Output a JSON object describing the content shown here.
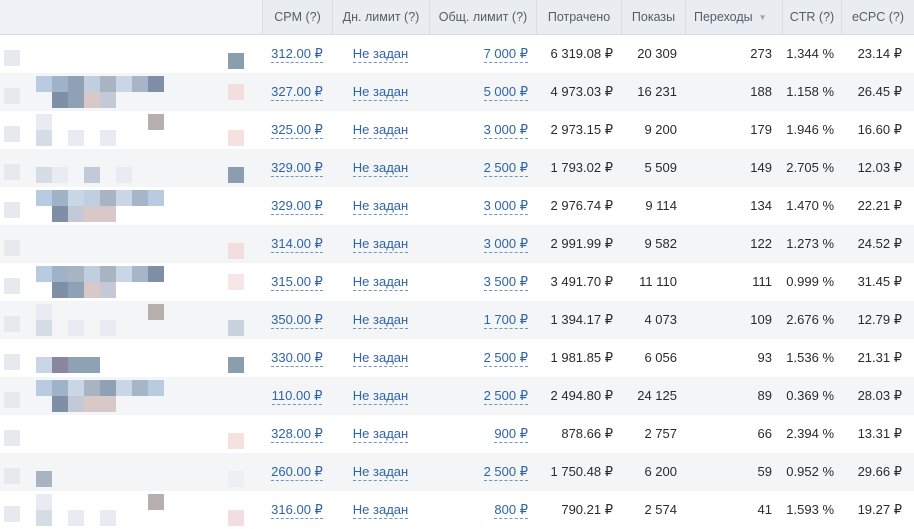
{
  "table": {
    "headers": {
      "cpm": "CPM (?)",
      "daily_limit": "Дн. лимит (?)",
      "total_limit": "Общ. лимит (?)",
      "spent": "Потрачено",
      "impressions": "Показы",
      "clicks": "Переходы",
      "ctr": "CTR (?)",
      "ecpc": "eCPC (?)"
    },
    "sorted_by": "clicks",
    "sort_direction": "descending",
    "rows": [
      {
        "cpm": "312.00 ₽",
        "daily": "Не задан",
        "total": "7 000 ₽",
        "spent": "6 319.08 ₽",
        "impressions": "20 309",
        "clicks": "273",
        "ctr": "1.344 %",
        "ecpc": "23.14 ₽"
      },
      {
        "cpm": "327.00 ₽",
        "daily": "Не задан",
        "total": "5 000 ₽",
        "spent": "4 973.03 ₽",
        "impressions": "16 231",
        "clicks": "188",
        "ctr": "1.158 %",
        "ecpc": "26.45 ₽"
      },
      {
        "cpm": "325.00 ₽",
        "daily": "Не задан",
        "total": "3 000 ₽",
        "spent": "2 973.15 ₽",
        "impressions": "9 200",
        "clicks": "179",
        "ctr": "1.946 %",
        "ecpc": "16.60 ₽"
      },
      {
        "cpm": "329.00 ₽",
        "daily": "Не задан",
        "total": "2 500 ₽",
        "spent": "1 793.02 ₽",
        "impressions": "5 509",
        "clicks": "149",
        "ctr": "2.705 %",
        "ecpc": "12.03 ₽"
      },
      {
        "cpm": "329.00 ₽",
        "daily": "Не задан",
        "total": "3 000 ₽",
        "spent": "2 976.74 ₽",
        "impressions": "9 114",
        "clicks": "134",
        "ctr": "1.470 %",
        "ecpc": "22.21 ₽"
      },
      {
        "cpm": "314.00 ₽",
        "daily": "Не задан",
        "total": "3 000 ₽",
        "spent": "2 991.99 ₽",
        "impressions": "9 582",
        "clicks": "122",
        "ctr": "1.273 %",
        "ecpc": "24.52 ₽"
      },
      {
        "cpm": "315.00 ₽",
        "daily": "Не задан",
        "total": "3 500 ₽",
        "spent": "3 491.70 ₽",
        "impressions": "11 110",
        "clicks": "111",
        "ctr": "0.999 %",
        "ecpc": "31.45 ₽"
      },
      {
        "cpm": "350.00 ₽",
        "daily": "Не задан",
        "total": "1 700 ₽",
        "spent": "1 394.17 ₽",
        "impressions": "4 073",
        "clicks": "109",
        "ctr": "2.676 %",
        "ecpc": "12.79 ₽"
      },
      {
        "cpm": "330.00 ₽",
        "daily": "Не задан",
        "total": "2 500 ₽",
        "spent": "1 981.85 ₽",
        "impressions": "6 056",
        "clicks": "93",
        "ctr": "1.536 %",
        "ecpc": "21.31 ₽"
      },
      {
        "cpm": "110.00 ₽",
        "daily": "Не задан",
        "total": "2 500 ₽",
        "spent": "2 494.80 ₽",
        "impressions": "24 125",
        "clicks": "89",
        "ctr": "0.369 %",
        "ecpc": "28.03 ₽"
      },
      {
        "cpm": "328.00 ₽",
        "daily": "Не задан",
        "total": "900 ₽",
        "spent": "878.66 ₽",
        "impressions": "2 757",
        "clicks": "66",
        "ctr": "2.394 %",
        "ecpc": "13.31 ₽"
      },
      {
        "cpm": "260.00 ₽",
        "daily": "Не задан",
        "total": "2 500 ₽",
        "spent": "1 750.48 ₽",
        "impressions": "6 200",
        "clicks": "59",
        "ctr": "0.952 %",
        "ecpc": "29.66 ₽"
      },
      {
        "cpm": "316.00 ₽",
        "daily": "Не задан",
        "total": "800 ₽",
        "spent": "790.21 ₽",
        "impressions": "2 574",
        "clicks": "41",
        "ctr": "1.593 %",
        "ecpc": "19.27 ₽"
      }
    ]
  },
  "colors": {
    "header_bg": "#e9edf2",
    "row_alt_bg": "#f3f5f7",
    "link": "#2f64a6",
    "text": "#2b2b2b"
  }
}
